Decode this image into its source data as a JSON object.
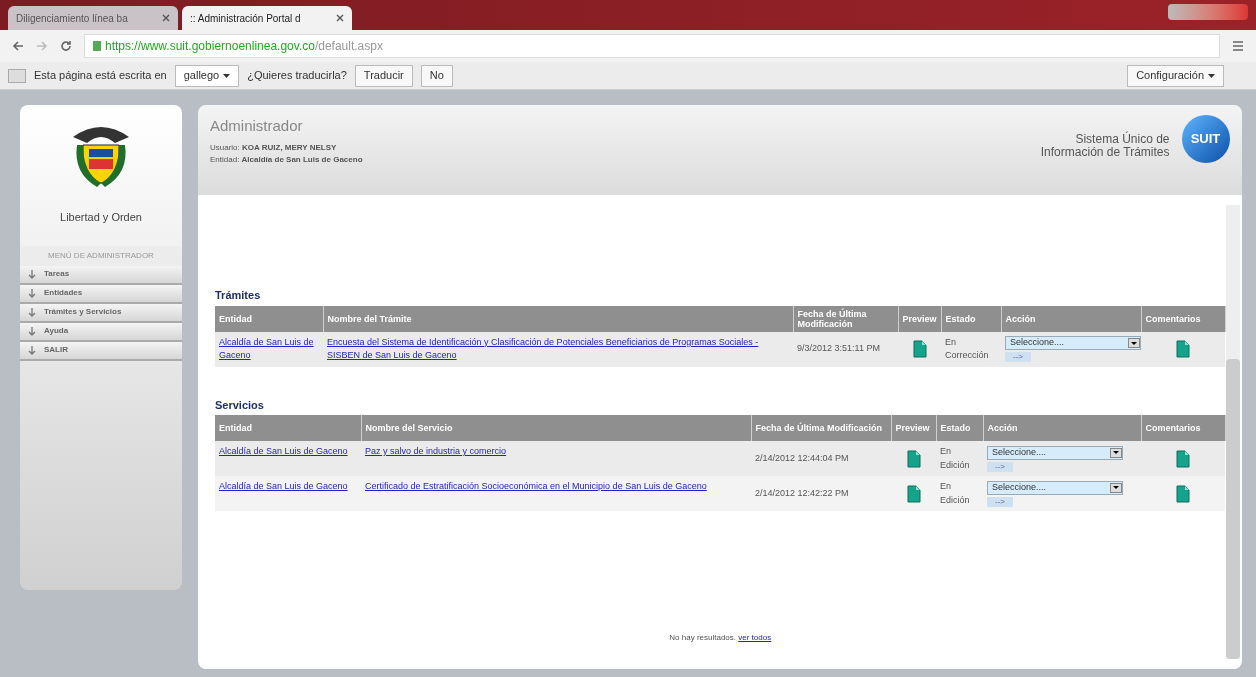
{
  "browser": {
    "tabs": [
      {
        "title": "Diligenciamiento línea ba",
        "selected": false
      },
      {
        "title": ":: Administración Portal d",
        "selected": true
      }
    ],
    "url_host": "https://www.suit.gobiernoenlinea.gov.co",
    "url_path": "/default.aspx"
  },
  "translate_bar": {
    "text_before": "Esta página está escrita en",
    "language": "gallego",
    "question": "¿Quieres traducirla?",
    "translate_button": "Traducir",
    "no_button": "No",
    "options_button": "Configuración"
  },
  "sidebar": {
    "motto": "Libertad y Orden",
    "menu_title": "MENÚ DE ADMINISTRADOR",
    "items": [
      {
        "label": "Tareas"
      },
      {
        "label": "Entidades"
      },
      {
        "label": "Trámites y Servicios"
      },
      {
        "label": "Ayuda"
      },
      {
        "label": "SALIR"
      }
    ]
  },
  "header": {
    "title": "Administrador",
    "user_label": "Usuario:",
    "user": "KOA RUIZ, MERY NELSY",
    "entity_label": "Entidad:",
    "entity": "Alcaldía de San Luis de Gaceno",
    "brand_line1": "Sistema Único de",
    "brand_line2": "Información de Trámites",
    "logo": "SUIT"
  },
  "sections": [
    {
      "title": "Trámites",
      "columns": [
        "Entidad",
        "Nombre del Trámite",
        "Fecha de Última Modificación",
        "Preview",
        "Estado",
        "Acción",
        "Comentarios"
      ],
      "rows": [
        {
          "entity": "Alcaldía de San Luis de Gaceno",
          "name": "Encuesta del Sistema de Identificación y Clasificación de Potenciales Beneficiarios de Programas Sociales - SISBEN de San Luis de Gaceno",
          "date": "9/3/2012 3:51:11 PM",
          "status": "En Corrección",
          "action": "Seleccione....",
          "go": "-->"
        }
      ]
    },
    {
      "title": "Servicios",
      "columns": [
        "Entidad",
        "Nombre del Servicio",
        "Fecha de Última Modificación",
        "Preview",
        "Estado",
        "Acción",
        "Comentarios"
      ],
      "rows": [
        {
          "entity": "Alcaldía de San Luis de Gaceno",
          "name": "Paz y salvo de industria y comercio",
          "date": "2/14/2012 12:44:04 PM",
          "status": "En Edición",
          "action": "Seleccione....",
          "go": "-->"
        },
        {
          "entity": "Alcaldía de San Luis de Gaceno",
          "name": "Certificado de Estratificación Socioeconómica en el Municipio de San Luis de Gaceno",
          "date": "2/14/2012 12:42:22 PM",
          "status": "En Edición",
          "action": "Seleccione....",
          "go": "-->"
        }
      ]
    }
  ],
  "footer": {
    "text": "No hay resultados.",
    "link": "ver todos"
  }
}
